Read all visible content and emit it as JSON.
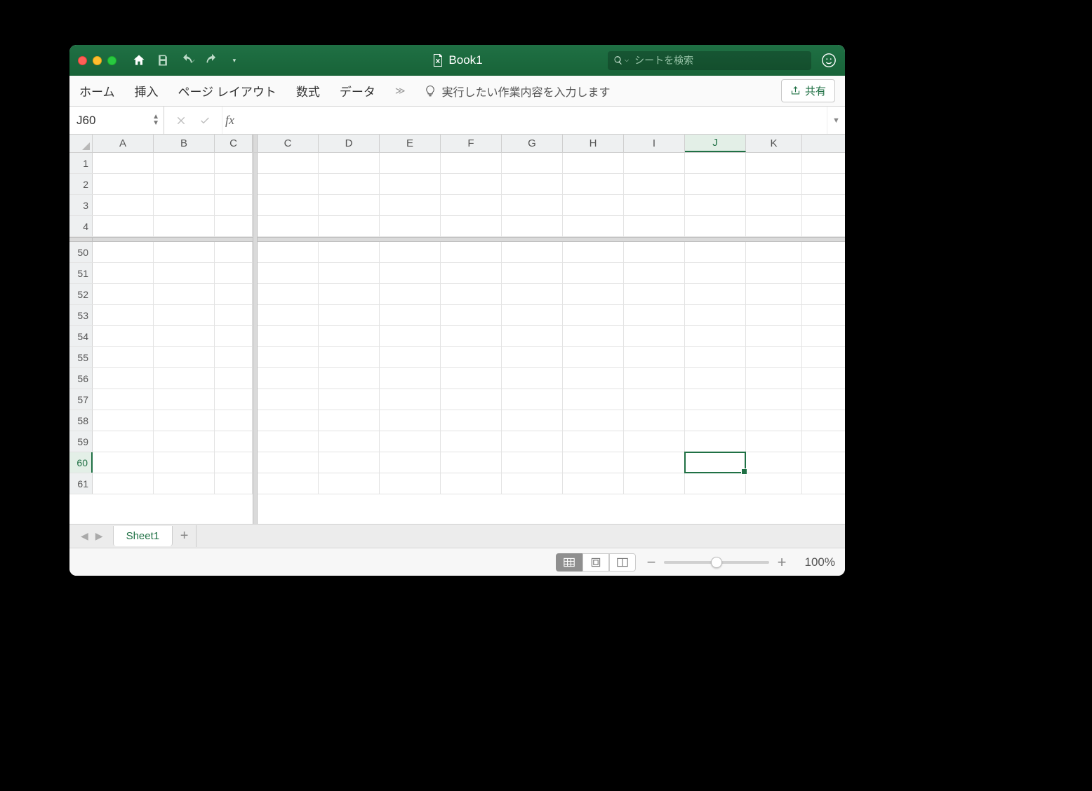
{
  "titlebar": {
    "document_name": "Book1",
    "search_placeholder": "シートを検索"
  },
  "ribbon": {
    "tabs": [
      "ホーム",
      "挿入",
      "ページ レイアウト",
      "数式",
      "データ"
    ],
    "more_glyph": "≫",
    "tellme_placeholder": "実行したい作業内容を入力します",
    "share_label": "共有"
  },
  "formula_bar": {
    "name_box": "J60",
    "fx_label": "fx",
    "formula": ""
  },
  "grid": {
    "columns_frozen": [
      "A",
      "B",
      "C"
    ],
    "columns_scroll": [
      "C",
      "D",
      "E",
      "F",
      "G",
      "H",
      "I",
      "J",
      "K"
    ],
    "rows_frozen": [
      1,
      2,
      3,
      4
    ],
    "rows_scroll": [
      50,
      51,
      52,
      53,
      54,
      55,
      56,
      57,
      58,
      59,
      60,
      61
    ],
    "col_widths_frozen": [
      87,
      87,
      54
    ],
    "col_width_scroll": 87,
    "col_width_scroll_last": 80,
    "selected_column": "J",
    "selected_row": 60
  },
  "sheets": {
    "active": "Sheet1"
  },
  "status": {
    "zoom": "100%"
  }
}
